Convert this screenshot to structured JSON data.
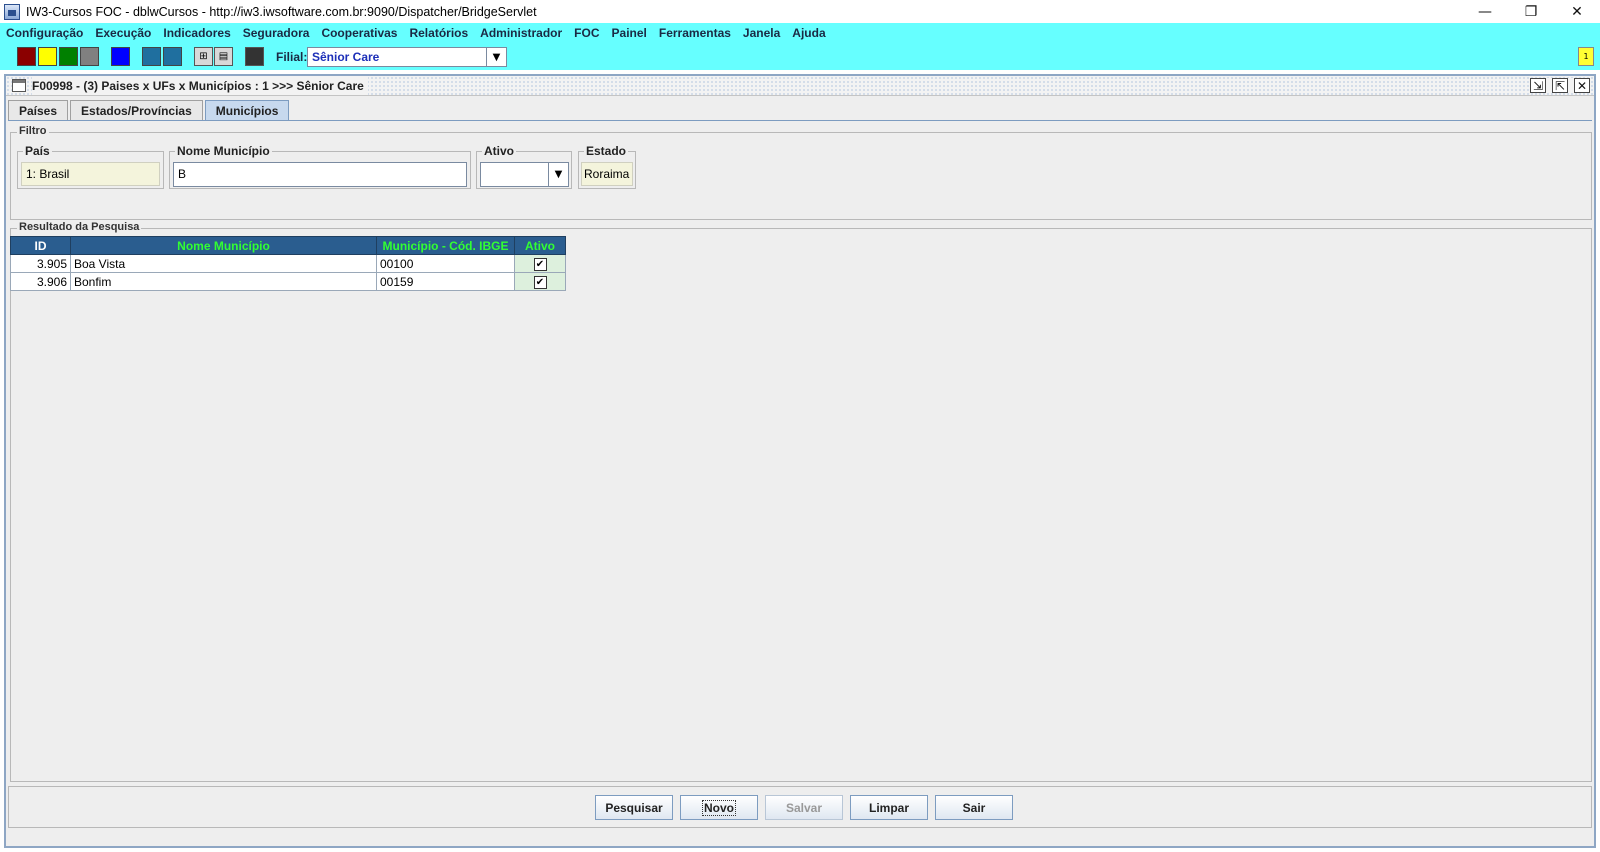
{
  "window": {
    "title": "IW3-Cursos FOC - dblwCursos - http://iw3.iwsoftware.com.br:9090/Dispatcher/BridgeServlet",
    "controls": [
      "—",
      "❐",
      "✕"
    ]
  },
  "menubar": [
    "Configuração",
    "Execução",
    "Indicadores",
    "Seguradora",
    "Cooperativas",
    "Relatórios",
    "Administrador",
    "FOC",
    "Painel",
    "Ferramentas",
    "Janela",
    "Ajuda"
  ],
  "toolbar": {
    "swatches": [
      "#8b0000",
      "#ffff00",
      "#008000",
      "#808080",
      "#0000ff",
      "#1f6f9f",
      "#1f6f9f"
    ],
    "filial_label": "Filial:",
    "filial_value": "Sênior Care",
    "notify_badge": "1"
  },
  "frame": {
    "title": "F00998 - (3) Paises x UFs x Municípios : 1 >>> Sênior Care",
    "tabs": [
      "Países",
      "Estados/Províncias",
      "Municípios"
    ],
    "active_tab": "Municípios"
  },
  "filter": {
    "legend": "Filtro",
    "pais": {
      "label": "País",
      "value": "1: Brasil"
    },
    "nome_municipio": {
      "label": "Nome Município",
      "value": "B"
    },
    "ativo": {
      "label": "Ativo",
      "value": ""
    },
    "estado": {
      "label": "Estado",
      "value": "Roraima"
    }
  },
  "results": {
    "legend": "Resultado da Pesquisa",
    "columns": [
      "ID",
      "Nome Município",
      "Município - Cód. IBGE",
      "Ativo"
    ],
    "rows": [
      {
        "id": "3.905",
        "nome": "Boa Vista",
        "ibge": "00100",
        "ativo": true
      },
      {
        "id": "3.906",
        "nome": "Bonfim",
        "ibge": "00159",
        "ativo": true
      }
    ]
  },
  "buttons": {
    "pesquisar": "Pesquisar",
    "novo": "Novo",
    "salvar": "Salvar",
    "limpar": "Limpar",
    "sair": "Sair"
  }
}
